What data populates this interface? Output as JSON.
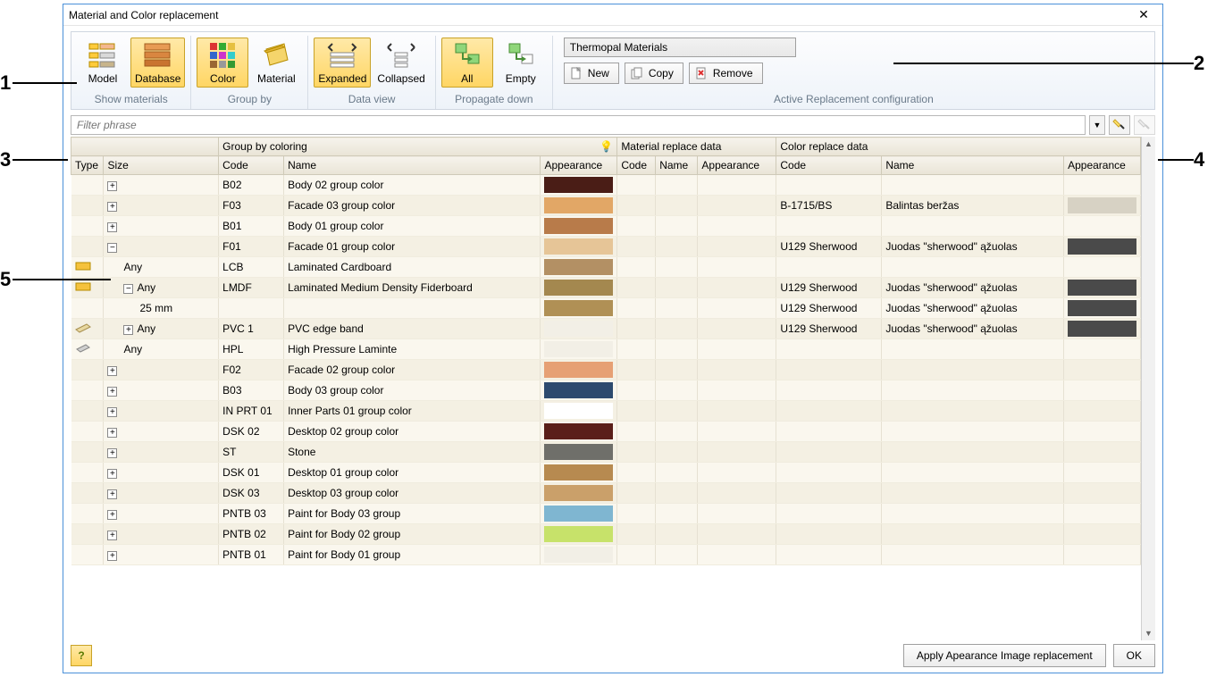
{
  "window": {
    "title": "Material and Color replacement"
  },
  "callouts": {
    "c1": "1",
    "c2": "2",
    "c3": "3",
    "c4": "4",
    "c5": "5"
  },
  "ribbon": {
    "show_materials": {
      "caption": "Show materials",
      "model": "Model",
      "database": "Database"
    },
    "group_by": {
      "caption": "Group by",
      "color": "Color",
      "material": "Material"
    },
    "data_view": {
      "caption": "Data view",
      "expanded": "Expanded",
      "collapsed": "Collapsed"
    },
    "propagate": {
      "caption": "Propagate down",
      "all": "All",
      "empty": "Empty"
    },
    "config": {
      "caption": "Active Replacement configuration",
      "value": "Thermopal Materials",
      "new": "New",
      "copy": "Copy",
      "remove": "Remove"
    }
  },
  "filter": {
    "placeholder": "Filter phrase"
  },
  "headers": {
    "group1": "Group by coloring",
    "group2": "Material replace data",
    "group3": "Color replace data",
    "type": "Type",
    "size": "Size",
    "code": "Code",
    "name": "Name",
    "appearance": "Appearance",
    "code2": "Code",
    "name2": "Name",
    "appearance2": "Appearance",
    "code3": "Code",
    "name3": "Name",
    "appearance3": "Appearance"
  },
  "rows": [
    {
      "exp": "+",
      "size": "",
      "code": "B02",
      "name": "Body 02 group color",
      "sw": "#4a1d16"
    },
    {
      "exp": "+",
      "size": "",
      "code": "F03",
      "name": "Facade 03 group color",
      "sw": "#e2a766",
      "c3": "B-1715/BS",
      "n3": "Balintas beržas",
      "sw3": "#d7d2c4"
    },
    {
      "exp": "+",
      "size": "",
      "code": "B01",
      "name": "Body 01 group color",
      "sw": "#b87b4a"
    },
    {
      "exp": "-",
      "size": "",
      "code": "F01",
      "name": "Facade 01 group color",
      "sw": "#e6c597",
      "c3": "U129 Sherwood",
      "n3": "Juodas \"sherwood\" ąžuolas",
      "sw3": "#4a4a4a"
    },
    {
      "type": "panel",
      "ind": 1,
      "size": "Any",
      "code": "LCB",
      "name": "Laminated Cardboard",
      "sw": "#b39064"
    },
    {
      "type": "panel",
      "ind": 1,
      "exp": "-",
      "size": "Any",
      "code": "LMDF",
      "name": "Laminated Medium Density Fiderboard",
      "sw": "#a4884f",
      "c3": "U129 Sherwood",
      "n3": "Juodas \"sherwood\" ąžuolas",
      "sw3": "#4a4a4a"
    },
    {
      "ind": 2,
      "size": "25 mm",
      "code": "",
      "name": "",
      "sw": "#b09055",
      "c3": "U129 Sherwood",
      "n3": "Juodas \"sherwood\" ąžuolas",
      "sw3": "#4a4a4a"
    },
    {
      "type": "edge",
      "ind": 1,
      "exp": "+",
      "size": "Any",
      "code": "PVC 1",
      "name": "PVC edge band",
      "sw": "#f2efe6",
      "c3": "U129 Sherwood",
      "n3": "Juodas \"sherwood\" ąžuolas",
      "sw3": "#4a4a4a"
    },
    {
      "type": "lam",
      "ind": 1,
      "size": "Any",
      "code": "HPL",
      "name": "High Pressure Laminte",
      "sw": "#f2efe6"
    },
    {
      "exp": "+",
      "size": "",
      "code": "F02",
      "name": "Facade 02 group color",
      "sw": "#e6a074"
    },
    {
      "exp": "+",
      "size": "",
      "code": "B03",
      "name": "Body 03 group color",
      "sw": "#2d4a6e"
    },
    {
      "exp": "+",
      "size": "",
      "code": "IN PRT 01",
      "name": "Inner Parts 01 group color",
      "sw": "#ffffff"
    },
    {
      "exp": "+",
      "size": "",
      "code": "DSK 02",
      "name": "Desktop 02 group color",
      "sw": "#5a1f1a"
    },
    {
      "exp": "+",
      "size": "",
      "code": "ST",
      "name": "Stone",
      "sw": "#6f6f6a"
    },
    {
      "exp": "+",
      "size": "",
      "code": "DSK 01",
      "name": "Desktop 01 group color",
      "sw": "#b78a50"
    },
    {
      "exp": "+",
      "size": "",
      "code": "DSK 03",
      "name": "Desktop 03 group color",
      "sw": "#caa06a"
    },
    {
      "exp": "+",
      "size": "",
      "code": "PNTB 03",
      "name": "Paint for Body 03 group",
      "sw": "#7fb6d1"
    },
    {
      "exp": "+",
      "size": "",
      "code": "PNTB 02",
      "name": "Paint for Body 02 group",
      "sw": "#c7e26a"
    },
    {
      "exp": "+",
      "size": "",
      "code": "PNTB 01",
      "name": "Paint for Body 01 group",
      "sw": "#f2efe6",
      "cut": true
    }
  ],
  "footer": {
    "apply": "Apply Apearance Image replacement",
    "ok": "OK"
  }
}
